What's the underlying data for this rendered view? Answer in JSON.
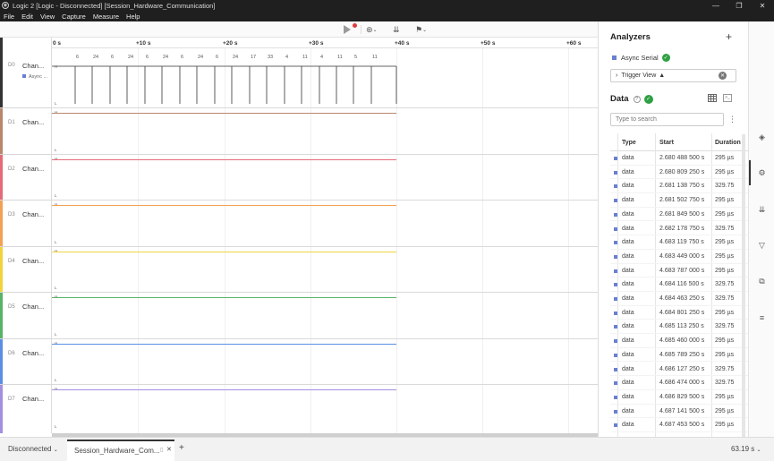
{
  "window": {
    "title": "Logic 2 [Logic - Disconnected] [Session_Hardware_Communication]",
    "controls": [
      "—",
      "❐",
      "✕"
    ]
  },
  "menu": [
    "File",
    "Edit",
    "View",
    "Capture",
    "Measure",
    "Help"
  ],
  "ruler": [
    "0 s",
    "+10 s",
    "+20 s",
    "+30 s",
    "+40 s",
    "+50 s",
    "+60 s"
  ],
  "channels": [
    {
      "id": "D0",
      "name": "Chan...",
      "sub": "Async ...",
      "color": "#333333"
    },
    {
      "id": "D1",
      "name": "Chan...",
      "color": "#b8876c"
    },
    {
      "id": "D2",
      "name": "Chan...",
      "color": "#e56a78"
    },
    {
      "id": "D3",
      "name": "Chan...",
      "color": "#f2a154"
    },
    {
      "id": "D4",
      "name": "Chan...",
      "color": "#f0d33e"
    },
    {
      "id": "D5",
      "name": "Chan...",
      "color": "#58b368"
    },
    {
      "id": "D6",
      "name": "Chan...",
      "color": "#5b8ee6"
    },
    {
      "id": "D7",
      "name": "Chan...",
      "color": "#a58de0"
    }
  ],
  "lane_markers": {
    "high": "H",
    "low": "L"
  },
  "decoded": [
    "6",
    "24",
    "6",
    "24",
    "6",
    "24",
    "6",
    "24",
    "6",
    "24",
    "17",
    "33",
    "4",
    "11",
    "4",
    "11",
    "5",
    "11"
  ],
  "panel": {
    "title": "Analyzers",
    "add": "+",
    "analyzer_name": "Async Serial",
    "trigger_label": "Trigger View",
    "data_title": "Data",
    "search_placeholder": "Type to search",
    "columns": [
      "Type",
      "Start",
      "Duration"
    ],
    "rows": [
      [
        "data",
        "2.680 488 500 s",
        "295 µs"
      ],
      [
        "data",
        "2.680 809 250 s",
        "295 µs"
      ],
      [
        "data",
        "2.681 138 750 s",
        "329.75"
      ],
      [
        "data",
        "2.681 502 750 s",
        "295 µs"
      ],
      [
        "data",
        "2.681 849 500 s",
        "295 µs"
      ],
      [
        "data",
        "2.682 178 750 s",
        "329.75"
      ],
      [
        "data",
        "4.683 119 750 s",
        "295 µs"
      ],
      [
        "data",
        "4.683 449 000 s",
        "295 µs"
      ],
      [
        "data",
        "4.683 787 000 s",
        "295 µs"
      ],
      [
        "data",
        "4.684 116 500 s",
        "329.75"
      ],
      [
        "data",
        "4.684 463 250 s",
        "329.75"
      ],
      [
        "data",
        "4.684 801 250 s",
        "295 µs"
      ],
      [
        "data",
        "4.685 113 250 s",
        "329.75"
      ],
      [
        "data",
        "4.685 460 000 s",
        "295 µs"
      ],
      [
        "data",
        "4.685 789 250 s",
        "295 µs"
      ],
      [
        "data",
        "4.686 127 250 s",
        "329.75"
      ],
      [
        "data",
        "4.686 474 000 s",
        "329.75"
      ],
      [
        "data",
        "4.686 829 500 s",
        "295 µs"
      ],
      [
        "data",
        "4.687 141 500 s",
        "295 µs"
      ],
      [
        "data",
        "4.687 453 500 s",
        "295 µs"
      ]
    ]
  },
  "bottom": {
    "status": "Disconnected",
    "tab": "Session_Hardware_Com...",
    "add_tab": "+",
    "duration": "63.19 s"
  }
}
